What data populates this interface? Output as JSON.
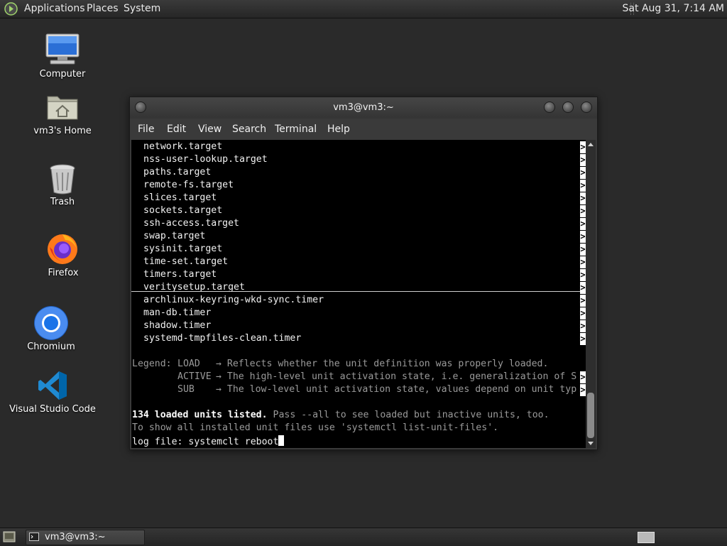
{
  "top_panel": {
    "menus": [
      "Applications",
      "Places",
      "System"
    ],
    "clock": "Sat Aug 31,  7:14 AM"
  },
  "desktop_icons": [
    {
      "label": "Computer",
      "icon": "computer-icon"
    },
    {
      "label": "vm3's Home",
      "icon": "home-folder-icon"
    },
    {
      "label": "Trash",
      "icon": "trash-icon"
    },
    {
      "label": "Firefox",
      "icon": "firefox-icon"
    },
    {
      "label": "Chromium",
      "icon": "chromium-icon"
    },
    {
      "label": "Visual Studio Code",
      "icon": "vscode-icon"
    }
  ],
  "window": {
    "title": "vm3@vm3:~",
    "menu": [
      "File",
      "Edit",
      "View",
      "Search",
      "Terminal",
      "Help"
    ]
  },
  "terminal": {
    "target_lines": [
      "network.target",
      "nss-user-lookup.target",
      "paths.target",
      "remote-fs.target",
      "slices.target",
      "sockets.target",
      "ssh-access.target",
      "swap.target",
      "sysinit.target",
      "time-set.target",
      "timers.target",
      "veritysetup.target"
    ],
    "timer_lines": [
      "archlinux-keyring-wkd-sync.timer",
      "man-db.timer",
      "shadow.timer",
      "systemd-tmpfiles-clean.timer"
    ],
    "truncation_marker": ">",
    "legend": {
      "prefix": "Legend:",
      "load_key": "LOAD",
      "load_text": "→ Reflects whether the unit definition was properly loaded.",
      "active_key": "ACTIVE",
      "active_text": "→ The high-level unit activation state, i.e. generalization of S",
      "sub_key": "SUB",
      "sub_text": "→ The low-level unit activation state, values depend on unit typ"
    },
    "summary_bold": "134 loaded units listed.",
    "summary_rest": " Pass --all to see loaded but inactive units, too.",
    "hint": "To show all installed unit files use 'systemctl list-unit-files'.",
    "prompt_line": "log file: systemclt reboot"
  },
  "taskbar": {
    "task_label": "vm3@vm3:~"
  },
  "colors": {
    "desktop_bg": "#2a2a2a",
    "terminal_bg": "#000000",
    "terminal_fg": "#f2f2f2",
    "terminal_dim": "#9a9a9a"
  }
}
